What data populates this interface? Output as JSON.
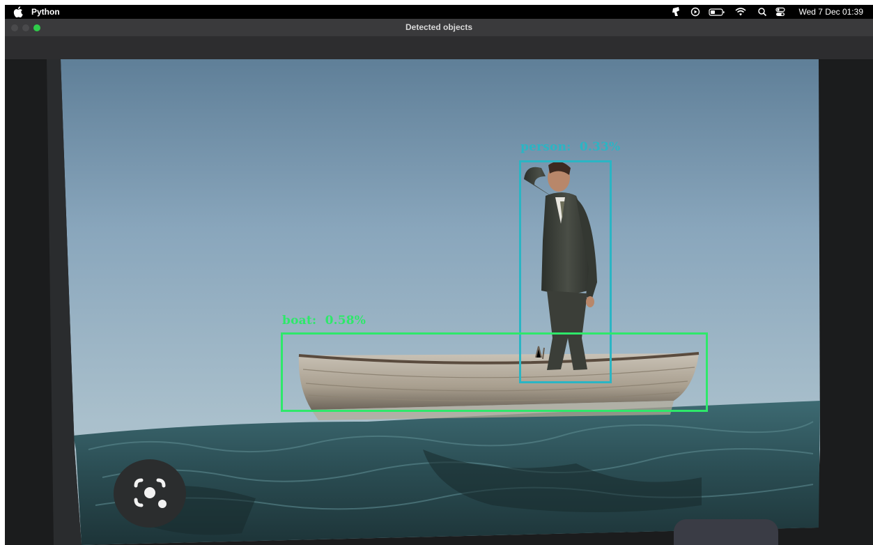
{
  "menubar": {
    "app_name": "Python",
    "clock": "Wed 7 Dec  01:39",
    "status_icons": [
      "inspector-icon",
      "play-circle-icon",
      "battery-icon",
      "wifi-icon",
      "search-icon",
      "control-center-icon"
    ]
  },
  "window": {
    "title": "Detected objects",
    "traffic_lights": [
      {
        "name": "close",
        "color": "#4a4a4c"
      },
      {
        "name": "minimize",
        "color": "#4a4a4c"
      },
      {
        "name": "zoom",
        "color": "#2fcc4a"
      }
    ]
  },
  "detections": [
    {
      "label": "person:  0.33%",
      "color": "#2bb5c4"
    },
    {
      "label": "boat:  0.58%",
      "color": "#2ee86a"
    }
  ],
  "overlay": {
    "capture_button": "screenshot-capture-icon"
  }
}
